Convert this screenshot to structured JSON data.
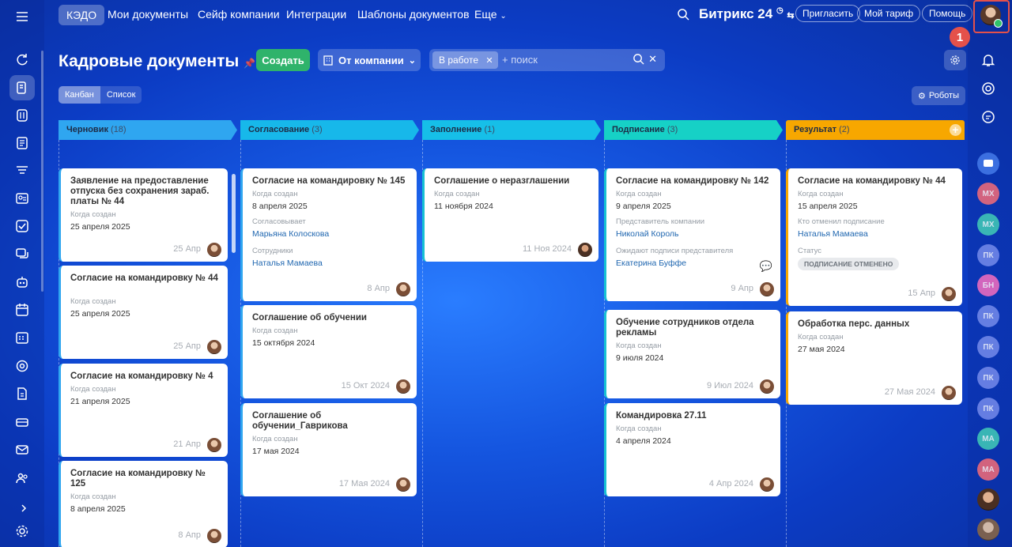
{
  "topnav": {
    "items": [
      "КЭДО",
      "Мои документы",
      "Сейф компании",
      "Интеграции",
      "Шаблоны документов",
      "Еще"
    ],
    "logo": "Битрикс 24",
    "invite": "Пригласить",
    "tariff": "Мой тариф",
    "help": "Помощь"
  },
  "annotation": "1",
  "header": {
    "title": "Кадровые документы",
    "create": "Создать",
    "from_company": "От компании",
    "filter_chip": "В работе",
    "search_placeholder": "+ поиск"
  },
  "view": {
    "kanban": "Канбан",
    "list": "Список",
    "robots": "Роботы"
  },
  "columns": [
    {
      "name": "Черновик",
      "count": "(18)",
      "color": "#2fa6f0"
    },
    {
      "name": "Согласование",
      "count": "(3)",
      "color": "#17b8ea"
    },
    {
      "name": "Заполнение",
      "count": "(1)",
      "color": "#16bfe8"
    },
    {
      "name": "Подписание",
      "count": "(3)",
      "color": "#16d1c6"
    },
    {
      "name": "Результат",
      "count": "(2)",
      "color": "#f7a700"
    }
  ],
  "cards": {
    "c1": [
      {
        "title": "Заявление на предоставление отпуска без сохранения зараб. платы № 44",
        "label": "Когда создан",
        "value": "25 апреля 2025",
        "date": "25 Апр"
      },
      {
        "title": "Согласие на командировку № 44",
        "label": "Когда создан",
        "value": "25 апреля 2025",
        "date": "25 Апр"
      },
      {
        "title": "Согласие на командировку № 4",
        "label": "Когда создан",
        "value": "21 апреля 2025",
        "date": "21 Апр"
      },
      {
        "title": "Согласие на командировку № 125",
        "label": "Когда создан",
        "value": "8 апреля 2025",
        "date": "8 Апр"
      }
    ],
    "c2": [
      {
        "title": "Согласие на командировку № 145",
        "label": "Когда создан",
        "value": "8 апреля 2025",
        "label2": "Согласовывает",
        "link2": "Марьяна Колоскова",
        "label3": "Сотрудники",
        "link3": "Наталья Мамаева",
        "date": "8 Апр"
      },
      {
        "title": "Соглашение об обучении",
        "label": "Когда создан",
        "value": "15 октября 2024",
        "date": "15 Окт 2024"
      },
      {
        "title": "Соглашение об обучении_Гаврикова",
        "label": "Когда создан",
        "value": "17 мая 2024",
        "date": "17 Мая 2024"
      }
    ],
    "c3": [
      {
        "title": "Соглашение о неразглашении",
        "label": "Когда создан",
        "value": "11 ноября 2024",
        "date": "11 Ноя 2024"
      }
    ],
    "c4": [
      {
        "title": "Согласие на командировку № 142",
        "label": "Когда создан",
        "value": "9 апреля 2025",
        "label2": "Представитель компании",
        "link2": "Николай Король",
        "label3": "Ожидают подписи представителя",
        "link3": "Екатерина Буффе",
        "date": "9 Апр"
      },
      {
        "title": "Обучение сотрудников отдела рекламы",
        "label": "Когда создан",
        "value": "9 июля 2024",
        "date": "9 Июл 2024"
      },
      {
        "title": "Командировка 27.11",
        "label": "Когда создан",
        "value": "4 апреля 2024",
        "date": "4 Апр 2024"
      }
    ],
    "c5": [
      {
        "title": "Согласие на командировку № 44",
        "label": "Когда создан",
        "value": "15 апреля 2025",
        "label2": "Кто отменил подписание",
        "link2": "Наталья Мамаева",
        "label3": "Статус",
        "status": "ПОДПИСАНИЕ ОТМЕНЕНО",
        "date": "15 Апр"
      },
      {
        "title": "Обработка перс. данных",
        "label": "Когда создан",
        "value": "27 мая 2024",
        "date": "27 Мая 2024"
      }
    ]
  },
  "rightbar": {
    "avatars": [
      {
        "initials": "МХ",
        "color": "#e8697a"
      },
      {
        "initials": "МХ",
        "color": "#3fc4b6"
      },
      {
        "initials": "ПК",
        "color": "#6f86e8"
      },
      {
        "initials": "БН",
        "color": "#e86bbf"
      },
      {
        "initials": "ПК",
        "color": "#6f86e8"
      },
      {
        "initials": "ПК",
        "color": "#6f86e8"
      },
      {
        "initials": "ПК",
        "color": "#6f86e8"
      },
      {
        "initials": "ПК",
        "color": "#6f86e8"
      },
      {
        "initials": "МА",
        "color": "#3fc4b6"
      },
      {
        "initials": "МА",
        "color": "#e8697a"
      }
    ]
  }
}
